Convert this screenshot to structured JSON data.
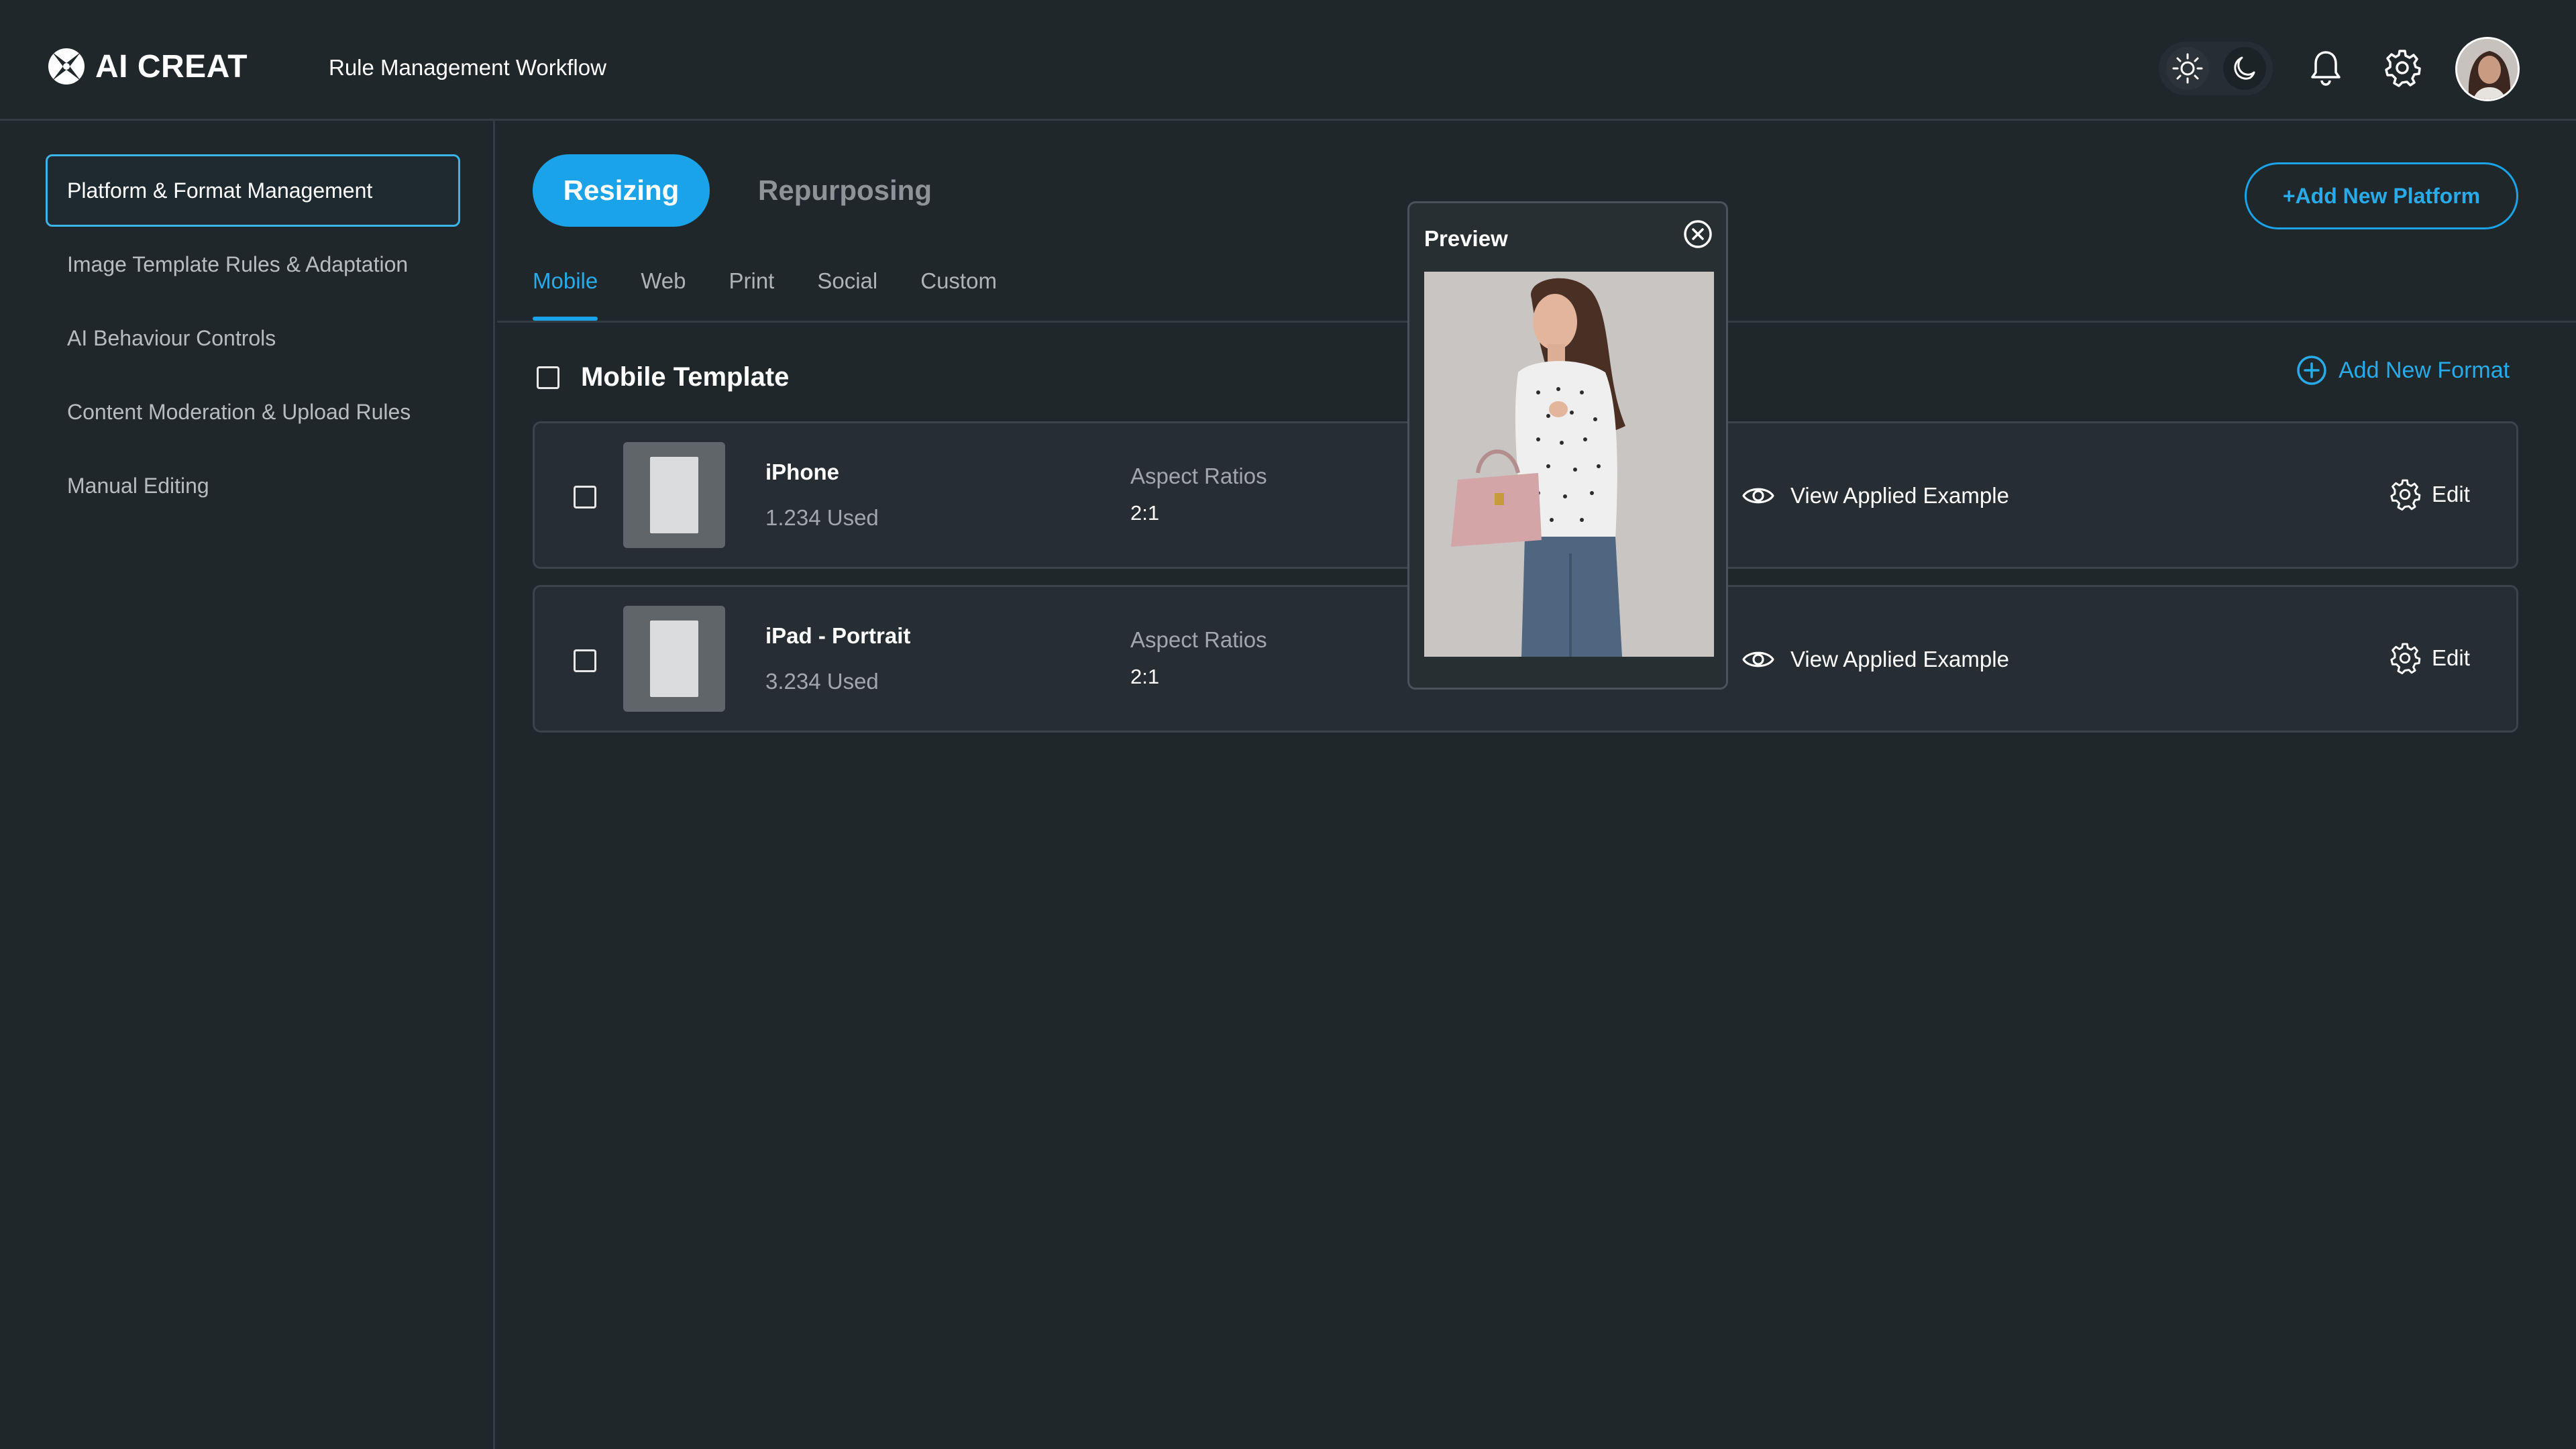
{
  "app": {
    "logo_text": "AI CREAT",
    "page_title": "Rule Management Workflow"
  },
  "header": {
    "icons": [
      "sun-icon",
      "moon-icon",
      "bell-icon",
      "gear-icon",
      "avatar"
    ]
  },
  "sidebar": {
    "items": [
      {
        "label": "Platform & Format Management",
        "active": true
      },
      {
        "label": "Image Template Rules & Adaptation",
        "active": false
      },
      {
        "label": "AI Behaviour Controls",
        "active": false
      },
      {
        "label": "Content Moderation & Upload Rules",
        "active": false
      },
      {
        "label": "Manual Editing",
        "active": false
      }
    ]
  },
  "main": {
    "tabs": [
      {
        "label": "Resizing",
        "active": true
      },
      {
        "label": "Repurposing",
        "active": false
      }
    ],
    "add_platform_label": "+Add New Platform",
    "subtabs": [
      {
        "label": "Mobile",
        "active": true
      },
      {
        "label": "Web",
        "active": false
      },
      {
        "label": "Print",
        "active": false
      },
      {
        "label": "Social",
        "active": false
      },
      {
        "label": "Custom",
        "active": false
      }
    ],
    "section_title": "Mobile Template",
    "add_format_label": "Add New Format",
    "rows": [
      {
        "name": "iPhone",
        "used": "1.234 Used",
        "ratio_label": "Aspect Ratios",
        "ratio": "2:1",
        "view_label": "View Applied Example",
        "edit_label": "Edit"
      },
      {
        "name": "iPad - Portrait",
        "used": "3.234 Used",
        "ratio_label": "Aspect Ratios",
        "ratio": "2:1",
        "view_label": "View Applied Example",
        "edit_label": "Edit"
      }
    ]
  },
  "preview": {
    "title": "Preview"
  },
  "colors": {
    "background": "#20272b",
    "accent": "#1aa3e8",
    "border": "#343c41"
  }
}
